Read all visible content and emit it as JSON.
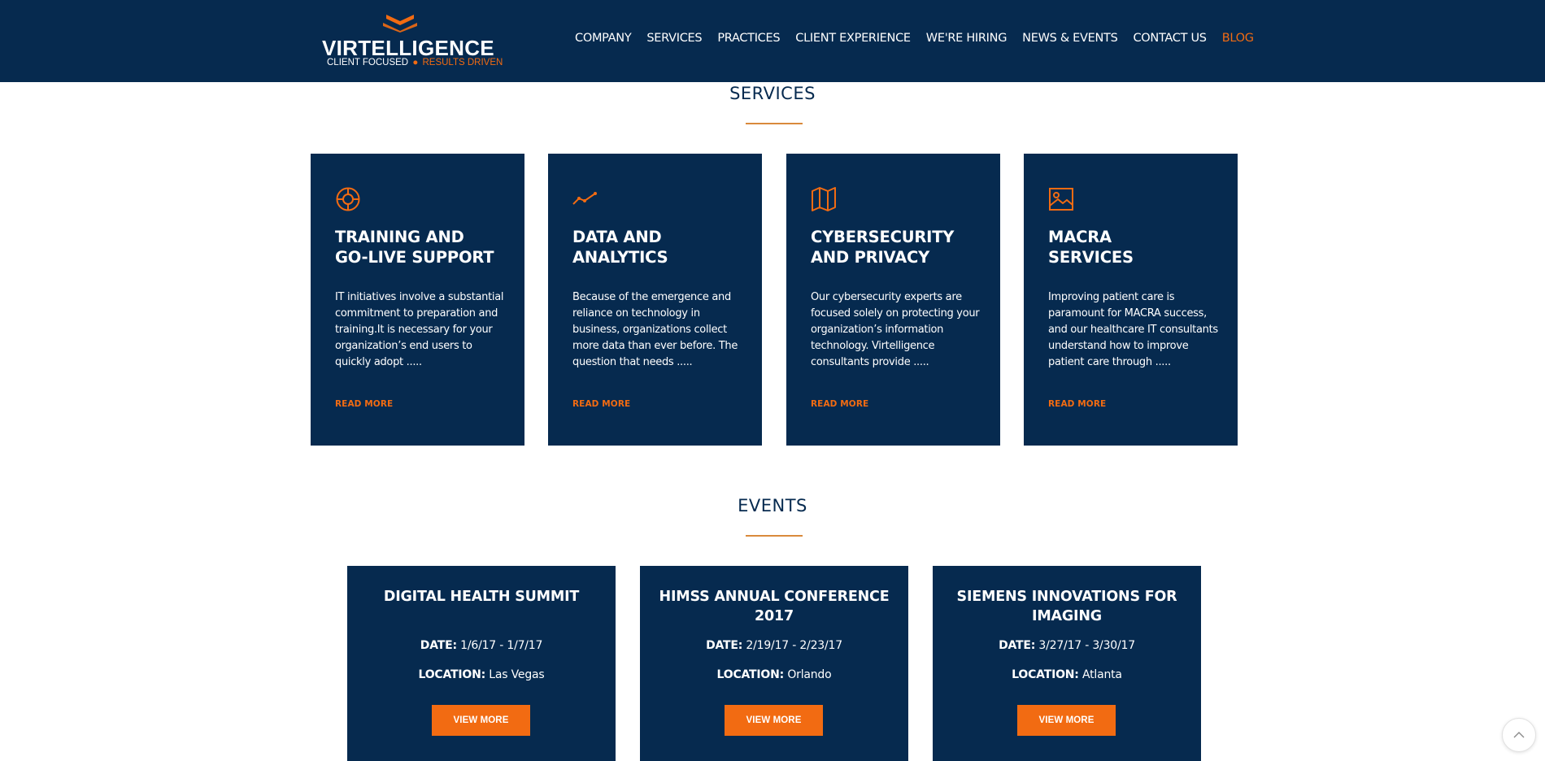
{
  "header": {
    "logo": {
      "name": "VIRTELLIGENCE",
      "tagline_left": "CLIENT FOCUSED",
      "tagline_dot": "●",
      "tagline_right": "RESULTS DRIVEN"
    },
    "nav": [
      {
        "label": "COMPANY"
      },
      {
        "label": "SERVICES"
      },
      {
        "label": "PRACTICES"
      },
      {
        "label": "CLIENT EXPERIENCE"
      },
      {
        "label": "WE'RE HIRING"
      },
      {
        "label": "NEWS & EVENTS"
      },
      {
        "label": "CONTACT US"
      },
      {
        "label": "BLOG"
      }
    ]
  },
  "services": {
    "title": "SERVICES",
    "cards": [
      {
        "icon": "lifebuoy-icon",
        "title": "TRAINING AND\nGO-LIVE SUPPORT",
        "desc": "IT initiatives involve a substantial commitment to preparation and training.It is necessary for your organization’s end users to quickly adopt .....",
        "more": "READ MORE"
      },
      {
        "icon": "trending-chart-icon",
        "title": "DATA AND\nANALYTICS",
        "desc": "Because of the emergence and reliance on technology in business, organizations collect more data than ever before. The question that needs .....",
        "more": "READ MORE"
      },
      {
        "icon": "map-icon",
        "title": "CYBERSECURITY\nAND PRIVACY",
        "desc": "Our cybersecurity experts are focused solely on protecting your organization’s information technology. Virtelligence consultants provide .....",
        "more": "READ MORE"
      },
      {
        "icon": "image-icon",
        "title": "MACRA\nSERVICES",
        "desc": "Improving patient care is paramount for MACRA success, and our healthcare IT consultants understand how to improve patient care through .....",
        "more": "READ MORE"
      }
    ]
  },
  "events": {
    "title": "EVENTS",
    "date_label": "DATE:",
    "location_label": "LOCATION:",
    "cards": [
      {
        "title": "DIGITAL HEALTH SUMMIT",
        "date": "1/6/17 - 1/7/17",
        "location": "Las Vegas",
        "button": "VIEW MORE"
      },
      {
        "title": "HIMSS ANNUAL CONFERENCE 2017",
        "date": "2/19/17 - 2/23/17",
        "location": "Orlando",
        "button": "VIEW MORE"
      },
      {
        "title": "SIEMENS INNOVATIONS FOR IMAGING",
        "date": "3/27/17 - 3/30/17",
        "location": "Atlanta",
        "button": "VIEW MORE"
      }
    ]
  },
  "scroll_top": {
    "icon": "chevron-up-icon"
  },
  "colors": {
    "navy": "#062a4f",
    "accent": "#f26b12",
    "underline": "#d98a3c"
  }
}
